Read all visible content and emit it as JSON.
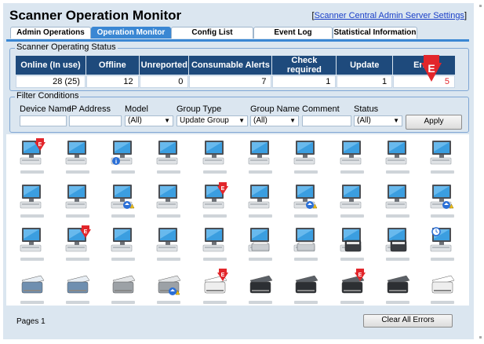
{
  "header": {
    "title": "Scanner Operation Monitor",
    "admin_link": "Scanner Central Admin Server Settings"
  },
  "tabs": [
    {
      "label": "Admin Operations",
      "active": false
    },
    {
      "label": "Operation Monitor",
      "active": true
    },
    {
      "label": "Config List",
      "active": false
    },
    {
      "label": "Event Log",
      "active": false
    },
    {
      "label": "Statistical Information",
      "active": false
    }
  ],
  "status": {
    "legend": "Scanner Operating Status",
    "columns": [
      "Online (In use)",
      "Offline",
      "Unreported",
      "Consumable Alerts",
      "Check required",
      "Update",
      "Error"
    ],
    "values": [
      "28 (25)",
      "12",
      "0",
      "7",
      "1",
      "1",
      "5"
    ],
    "error_badge": "E"
  },
  "filter": {
    "legend": "Filter Conditions",
    "labels": {
      "device_name": "Device Name",
      "ip_address": "IP Address",
      "model": "Model",
      "group_type": "Group Type",
      "group_name": "Group Name",
      "comment": "Comment",
      "status": "Status"
    },
    "values": {
      "model": "(All)",
      "group_type": "Update Group",
      "group_name": "(All)",
      "status": "(All)"
    },
    "apply_label": "Apply"
  },
  "scanners": [
    [
      "monitor-error",
      "monitor",
      "monitor-info",
      "monitor",
      "monitor",
      "monitor",
      "monitor",
      "monitor",
      "monitor",
      "monitor"
    ],
    [
      "monitor",
      "monitor",
      "monitor-update",
      "monitor",
      "monitor-error",
      "monitor",
      "monitor-update",
      "monitor",
      "monitor",
      "monitor-update"
    ],
    [
      "monitor",
      "monitor-error",
      "monitor",
      "monitor",
      "monitor",
      "monitor-flatbed",
      "monitor-flatbed",
      "monitor-scanner",
      "monitor-scanner",
      "monitor-clock"
    ],
    [
      "scanner-blue",
      "scanner-blue",
      "scanner-gray",
      "scanner-update",
      "scanner-white-error",
      "scanner-black",
      "scanner-black",
      "scanner-black-error",
      "scanner-black",
      "scanner-white"
    ]
  ],
  "footer": {
    "pages": "Pages 1",
    "clear_label": "Clear All Errors"
  },
  "colors": {
    "tab_active": "#3a87d3",
    "header_cell": "#1e4a7c",
    "error": "#e2262b",
    "background": "#dbe6f0"
  }
}
